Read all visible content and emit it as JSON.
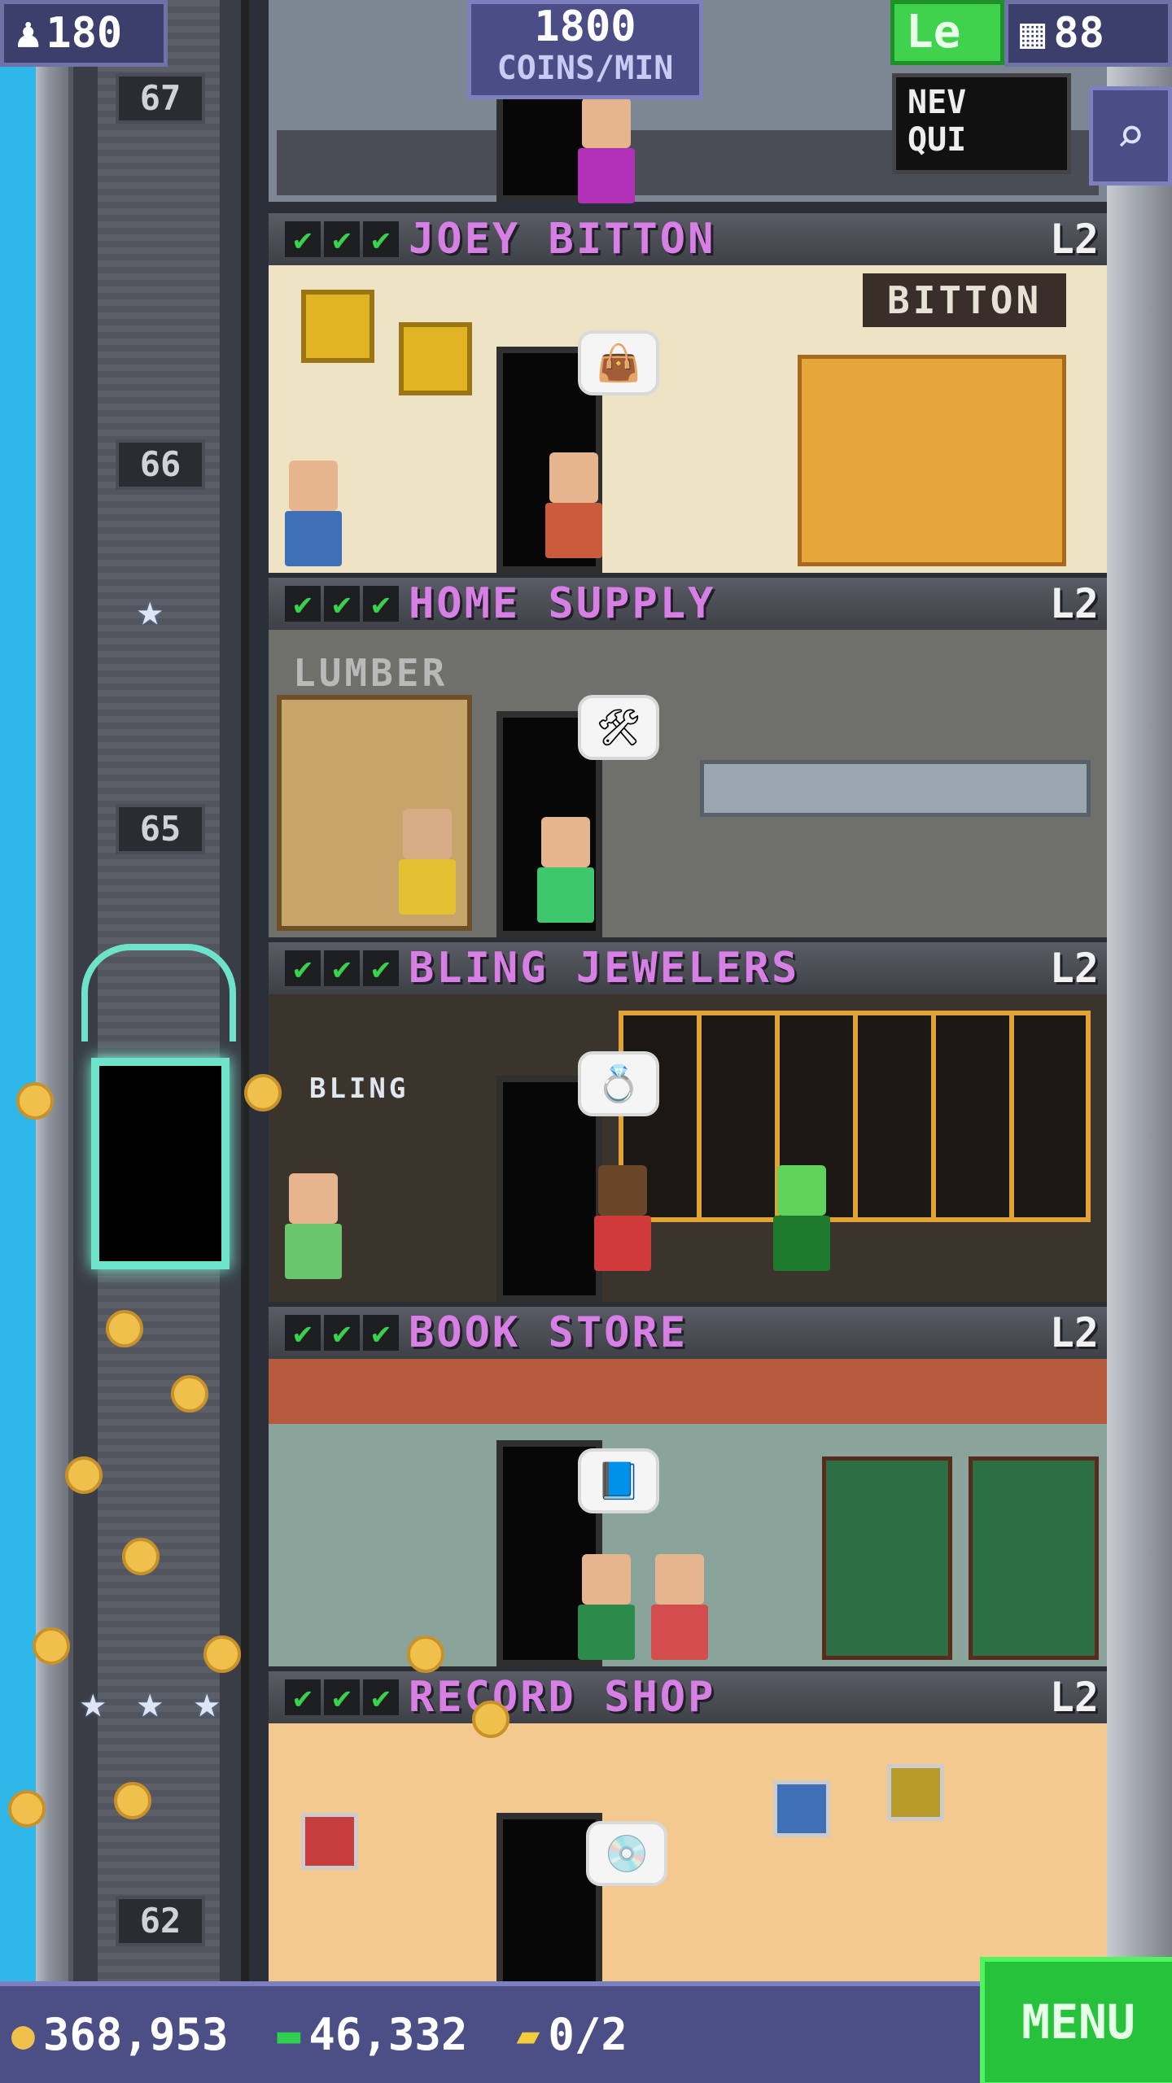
{
  "top": {
    "population": "180",
    "coins_rate_value": "1800",
    "coins_rate_unit": "COINS/MIN",
    "level_label": "Le",
    "floors_count": "88",
    "quest_line1": "NEV",
    "quest_line2": "QUI"
  },
  "elevator": {
    "floor_labels": [
      "67",
      "66",
      "65",
      "62"
    ]
  },
  "floors": [
    {
      "name": "JOEY BITTON",
      "level": "L2",
      "sign": "BITTON",
      "bubble": "👜"
    },
    {
      "name": "HOME SUPPLY",
      "level": "L2",
      "sign": "LUMBER",
      "bubble": "🛠"
    },
    {
      "name": "BLING JEWELERS",
      "level": "L2",
      "sign": "BLING",
      "bubble": "💍"
    },
    {
      "name": "BOOK STORE",
      "level": "L2",
      "sign": "",
      "bubble": "📘"
    },
    {
      "name": "RECORD SHOP",
      "level": "L2",
      "sign": "",
      "bubble": "💿"
    }
  ],
  "bottom": {
    "coins": "368,953",
    "bux": "46,332",
    "tickets": "0/2",
    "menu_label": "MENU"
  },
  "colors": {
    "accent_purple": "#4a4d86",
    "floor_name": "#d77fe5",
    "menu_green": "#27c23b",
    "sky": "#2fb7ea"
  },
  "icons": [
    "person-icon",
    "grid-icon",
    "search-icon",
    "coin-icon",
    "bux-icon",
    "ticket-icon",
    "star-icon",
    "check-icon"
  ]
}
